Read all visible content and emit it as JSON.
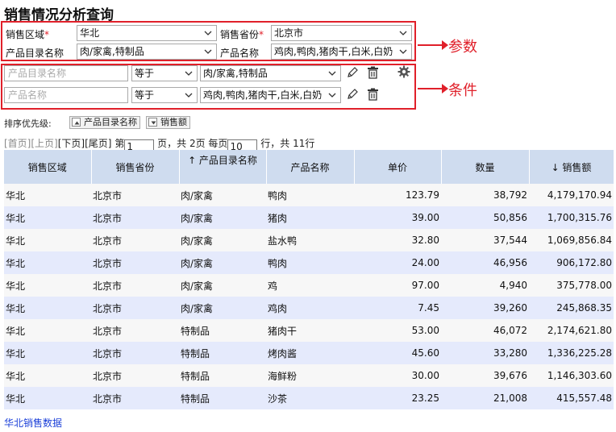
{
  "page_title": "销售情况分析查询",
  "annotations": {
    "params": "参数",
    "conditions": "条件"
  },
  "params": {
    "region_label": "销售区域",
    "region_value": "华北",
    "province_label": "销售省份",
    "province_value": "北京市",
    "category_label": "产品目录名称",
    "category_value": "肉/家禽,特制品",
    "product_label": "产品名称",
    "product_value": "鸡肉,鸭肉,猪肉干,白米,白奶",
    "required_mark": "*"
  },
  "conditions": [
    {
      "field_placeholder": "产品目录名称",
      "operator": "等于",
      "value": "肉/家禽,特制品"
    },
    {
      "field_placeholder": "产品名称",
      "operator": "等于",
      "value": "鸡肉,鸭肉,猪肉干,白米,白奶"
    }
  ],
  "sort": {
    "label": "排序优先级:",
    "key1": "产品目录名称",
    "key2": "销售额"
  },
  "pager": {
    "first": "[首页]",
    "prev": "[上页]",
    "next": "[下页]",
    "last": "[尾页]",
    "page_prefix": "第",
    "page_value": "1",
    "page_mid": "页，共 2页 每页",
    "rows_value": "10",
    "rows_suffix": "行，共 11行"
  },
  "table": {
    "headers": [
      "销售区域",
      "销售省份",
      "↑ 产品目录名称",
      "产品名称",
      "单价",
      "数量",
      "↓ 销售额"
    ],
    "rows": [
      [
        "华北",
        "北京市",
        "肉/家禽",
        "鸭肉",
        "123.79",
        "38,792",
        "4,179,170.94"
      ],
      [
        "华北",
        "北京市",
        "肉/家禽",
        "猪肉",
        "39.00",
        "50,856",
        "1,700,315.76"
      ],
      [
        "华北",
        "北京市",
        "肉/家禽",
        "盐水鸭",
        "32.80",
        "37,544",
        "1,069,856.84"
      ],
      [
        "华北",
        "北京市",
        "肉/家禽",
        "鸭肉",
        "24.00",
        "46,956",
        "906,172.80"
      ],
      [
        "华北",
        "北京市",
        "肉/家禽",
        "鸡",
        "97.00",
        "4,940",
        "375,778.00"
      ],
      [
        "华北",
        "北京市",
        "肉/家禽",
        "鸡肉",
        "7.45",
        "39,260",
        "245,868.35"
      ],
      [
        "华北",
        "北京市",
        "特制品",
        "猪肉干",
        "53.00",
        "46,072",
        "2,174,621.80"
      ],
      [
        "华北",
        "北京市",
        "特制品",
        "烤肉酱",
        "45.60",
        "33,280",
        "1,336,225.28"
      ],
      [
        "华北",
        "北京市",
        "特制品",
        "海鲜粉",
        "30.00",
        "39,676",
        "1,146,303.60"
      ],
      [
        "华北",
        "北京市",
        "特制品",
        "沙茶",
        "23.25",
        "21,008",
        "415,557.48"
      ]
    ]
  },
  "footer_link": "华北销售数据"
}
